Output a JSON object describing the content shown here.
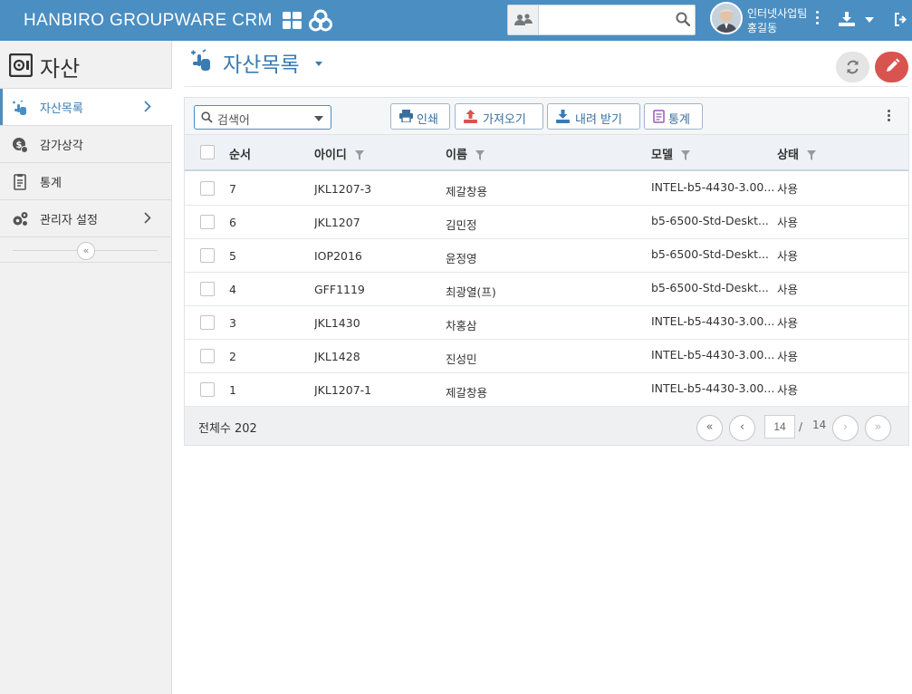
{
  "topbar": {
    "brand": "HANBIRO GROUPWARE CRM",
    "search_placeholder": "",
    "user_org": "인터넷사업팀",
    "user_name": "홍길동"
  },
  "sidebar": {
    "title": "자산",
    "items": [
      {
        "label": "자산목록",
        "icon": "pointer-hand-icon",
        "active": true,
        "has_chevron": true
      },
      {
        "label": "감가상각",
        "icon": "dollar-gear-icon",
        "active": false,
        "has_chevron": false
      },
      {
        "label": "통계",
        "icon": "report-icon",
        "active": false,
        "has_chevron": false
      },
      {
        "label": "관리자 설정",
        "icon": "gears-icon",
        "active": false,
        "has_chevron": true
      }
    ],
    "collapse_symbol": "«"
  },
  "page": {
    "title": "자산목록"
  },
  "toolbar": {
    "filter_placeholder": "검색어",
    "print_label": "인쇄",
    "import_label": "가져오기",
    "download_label": "내려 받기",
    "stats_label": "통계"
  },
  "table": {
    "columns": {
      "order": "순서",
      "id": "아이디",
      "name": "이름",
      "model": "모델",
      "status": "상태"
    },
    "rows": [
      {
        "order": "7",
        "id": "JKL1207-3",
        "name": "제갈창용",
        "model": "INTEL-b5-4430-3.00...",
        "status": "사용"
      },
      {
        "order": "6",
        "id": "JKL1207",
        "name": "김민정",
        "model": "b5-6500-Std-Deskt...",
        "status": "사용"
      },
      {
        "order": "5",
        "id": "IOP2016",
        "name": "윤정영",
        "model": "b5-6500-Std-Deskt...",
        "status": "사용"
      },
      {
        "order": "4",
        "id": "GFF1119",
        "name": "최광열(프)",
        "model": "b5-6500-Std-Deskt...",
        "status": "사용"
      },
      {
        "order": "3",
        "id": "JKL1430",
        "name": "차홍삼",
        "model": "INTEL-b5-4430-3.00...",
        "status": "사용"
      },
      {
        "order": "2",
        "id": "JKL1428",
        "name": "진성민",
        "model": "INTEL-b5-4430-3.00...",
        "status": "사용"
      },
      {
        "order": "1",
        "id": "JKL1207-1",
        "name": "제갈창용",
        "model": "INTEL-b5-4430-3.00...",
        "status": "사용"
      }
    ]
  },
  "footer": {
    "total": "전체수 202",
    "first": "«",
    "prev": "‹",
    "next": "›",
    "last": "»",
    "current_page": "14",
    "separator": "/",
    "total_pages": "14"
  },
  "colors": {
    "topbar": "#4a8ec2",
    "accent": "#3a7bb3",
    "edit_button": "#d9534f"
  }
}
